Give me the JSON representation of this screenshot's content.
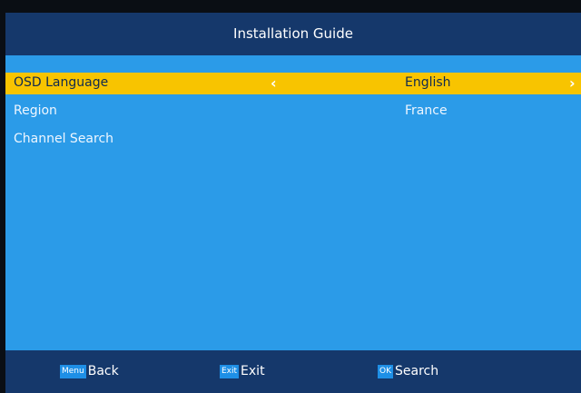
{
  "header": {
    "title": "Installation Guide"
  },
  "menu": {
    "items": [
      {
        "label": "OSD Language",
        "value": "English",
        "selected": true
      },
      {
        "label": "Region",
        "value": "France",
        "selected": false
      },
      {
        "label": "Channel Search",
        "value": "",
        "selected": false
      }
    ],
    "left_arrow": "‹",
    "right_arrow": "›"
  },
  "footer": {
    "hints": [
      {
        "key": "Menu",
        "label": "Back"
      },
      {
        "key": "Exit",
        "label": "Exit"
      },
      {
        "key": "OK",
        "label": "Search"
      }
    ]
  },
  "colors": {
    "background": "#2b9be8",
    "bar": "#15386b",
    "highlight": "#f8c400",
    "key_badge": "#1e8fe6"
  }
}
